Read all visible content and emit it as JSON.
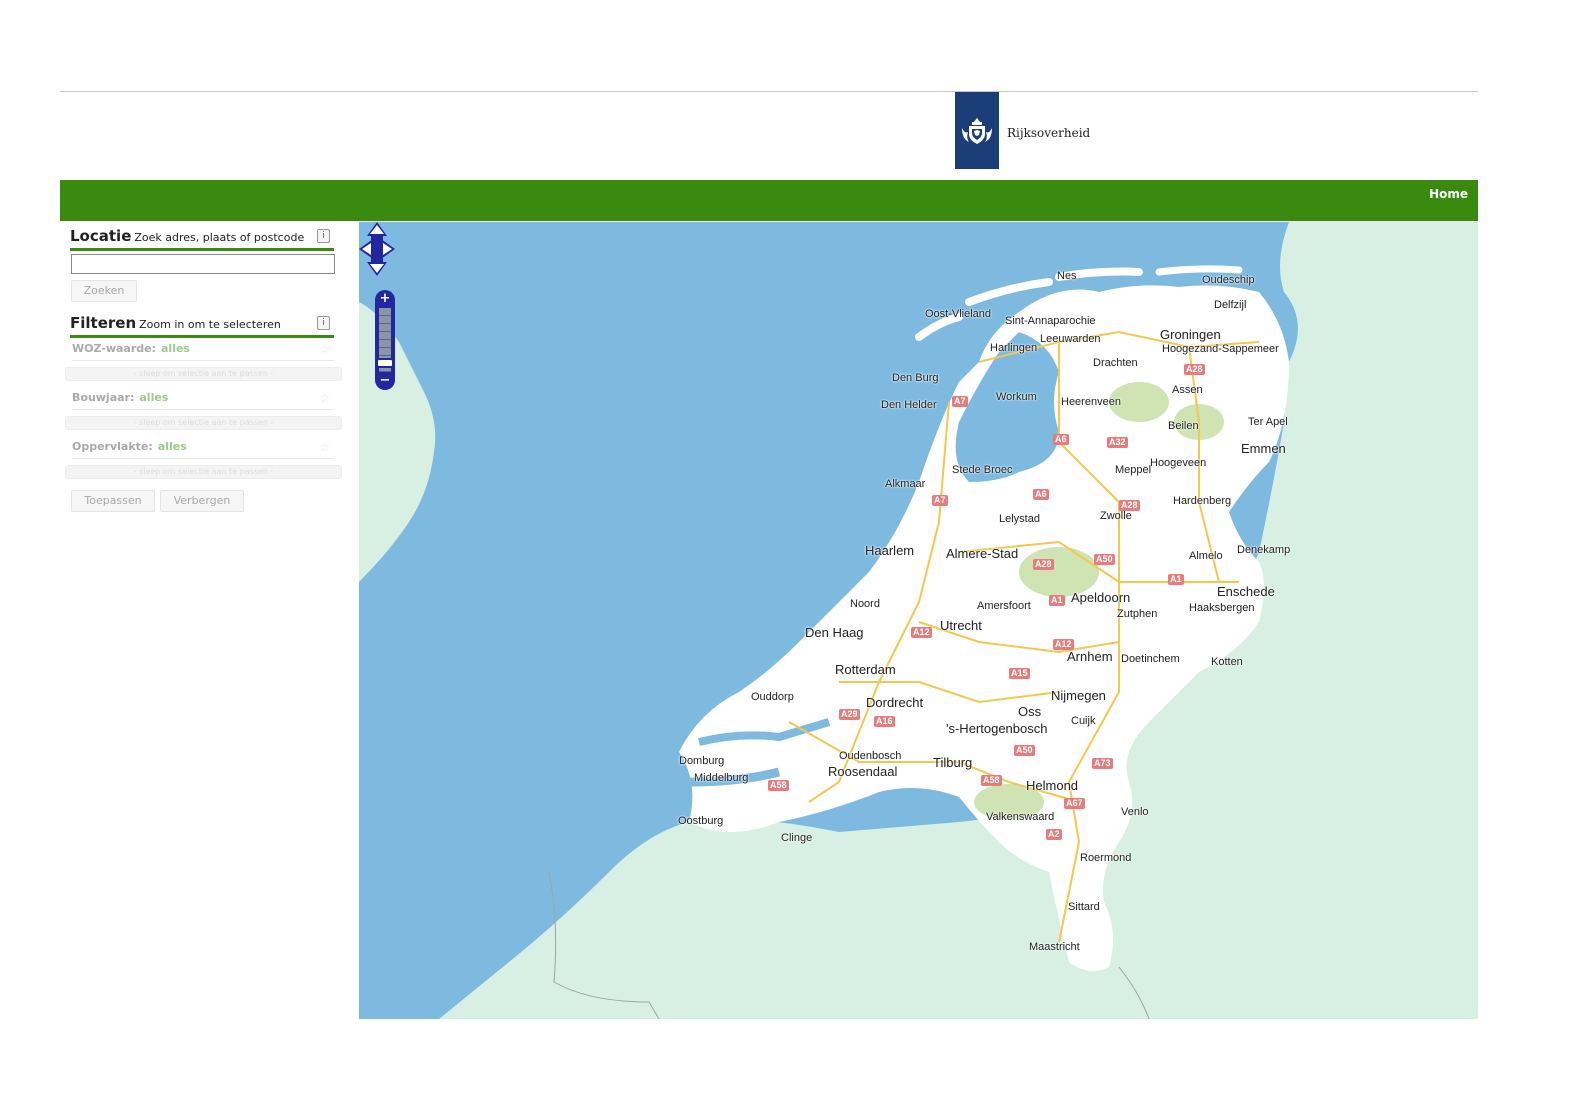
{
  "header": {
    "brand_text": "Rijksoverheid",
    "nav_home": "Home"
  },
  "colors": {
    "nav_green": "#3a8a10",
    "brand_blue": "#1b3e78",
    "sea": "#7ebae0",
    "land_abroad": "#d8efe3",
    "land_nl": "#ffffff",
    "highway_badge": "#e87b7b"
  },
  "sidebar": {
    "locatie": {
      "title": "Locatie",
      "subtitle": "Zoek adres, plaats of postcode",
      "info": "i",
      "input_value": "",
      "search_button": "Zoeken"
    },
    "filteren": {
      "title": "Filteren",
      "subtitle": "Zoom in om te selecteren",
      "info": "i",
      "filters": [
        {
          "label": "WOZ-waarde:",
          "value": "alles",
          "hint": "- sleep om selectie aan te passen -"
        },
        {
          "label": "Bouwjaar:",
          "value": "alles",
          "hint": "- sleep om selectie aan te passen -"
        },
        {
          "label": "Oppervlakte:",
          "value": "alles",
          "hint": "- sleep om selectie aan te passen -"
        }
      ],
      "apply_button": "Toepassen",
      "hide_button": "Verbergen"
    }
  },
  "map": {
    "zoom_in": "+",
    "zoom_out": "−",
    "places": [
      "Nes",
      "Oudeschip",
      "Delfzijl",
      "Oost-Vlieland",
      "Sint-Annaparochie",
      "Groningen",
      "Harlingen",
      "Leeuwarden",
      "Hoogezand-Sappemeer",
      "Drachten",
      "Den Burg",
      "Assen",
      "Den Helder",
      "Workum",
      "Heerenveen",
      "Beilen",
      "Ter Apel",
      "Emmen",
      "Meppel",
      "Hoogeveen",
      "Stede Broec",
      "Alkmaar",
      "Hardenberg",
      "Lelystad",
      "Zwolle",
      "Haarlem",
      "Almere-Stad",
      "Almelo",
      "Denekamp",
      "Enschede",
      "Noord",
      "Amersfoort",
      "Apeldoorn",
      "Haaksbergen",
      "Zutphen",
      "Den Haag",
      "Utrecht",
      "Arnhem",
      "Doetinchem",
      "Kotten",
      "Rotterdam",
      "Ouddorp",
      "Dordrecht",
      "Nijmegen",
      "Oss",
      "Cuijk",
      "'s-Hertogenbosch",
      "Domburg",
      "Oudenbosch",
      "Middelburg",
      "Roosendaal",
      "Tilburg",
      "Helmond",
      "Oostburg",
      "Valkenswaard",
      "Venlo",
      "Clinge",
      "Roermond",
      "Sittard",
      "Maastricht"
    ],
    "roads": [
      "A7",
      "A28",
      "A6",
      "A32",
      "A7",
      "A6",
      "A28",
      "A28",
      "A50",
      "A1",
      "A1",
      "A12",
      "A12",
      "A15",
      "A29",
      "A16",
      "A50",
      "A73",
      "A58",
      "A58",
      "A67",
      "A2"
    ]
  }
}
